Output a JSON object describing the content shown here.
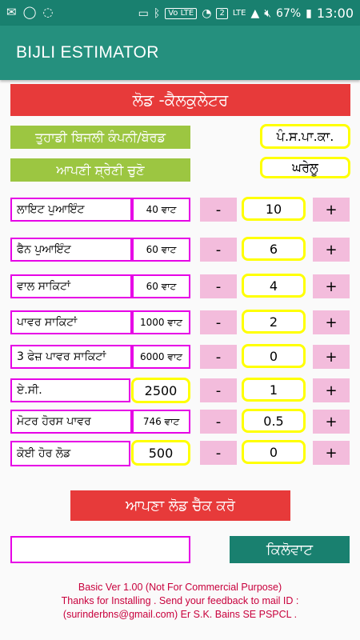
{
  "status_bar": {
    "left_icons": [
      "sms-icon",
      "whatsapp-icon",
      "messenger-icon"
    ],
    "battery": "67%",
    "time": "13:00",
    "volte": "Vo LTE",
    "sim2": "2",
    "lte": "LTE"
  },
  "app": {
    "title": "BIJLI ESTIMATOR"
  },
  "header": {
    "title": "ਲੋਡ -ਕੈਲਕੁਲੇਟਰ"
  },
  "company": {
    "label": "ਤੁਹਾਡੀ ਬਿਜਲੀ ਕੰਪਨੀ/ਬੋਰਡ",
    "value": "ਪੰ.ਸ.ਪਾ.ਕਾ."
  },
  "category": {
    "label": "ਆਪਣੀ ਸ਼੍ਰੇਣੀ ਚੁਣੋ",
    "value": "ਘਰੇਲੂ"
  },
  "load_items": [
    {
      "name": "ਲਾਇਟ ਪੁਆਇੰਟ",
      "watt": "40 ਵਾਟ",
      "qty": "10"
    },
    {
      "name": "ਫੈਨ ਪੁਆਇੰਟ",
      "watt": "60 ਵਾਟ",
      "qty": "6"
    },
    {
      "name": "ਵਾਲ ਸਾਕਿਟਾਂ",
      "watt": "60 ਵਾਟ",
      "qty": "4"
    },
    {
      "name": "ਪਾਵਰ ਸਾਕਿਟਾਂ",
      "watt": "1000 ਵਾਟ",
      "qty": "2"
    },
    {
      "name": "3 ਫੇਜ਼ ਪਾਵਰ ਸਾਕਿਟਾਂ",
      "watt": "6000 ਵਾਟ",
      "qty": "0"
    },
    {
      "name": "ਏ.ਸੀ.",
      "watt": "2500",
      "qty": "1"
    },
    {
      "name": "ਮੋਟਰ ਹੋਰਸ ਪਾਵਰ",
      "watt": "746 ਵਾਟ",
      "qty": "0.5"
    },
    {
      "name": "ਕੋਈ ਹੋਰ ਲੋਡ",
      "watt": "500",
      "qty": "0"
    }
  ],
  "buttons": {
    "minus": "-",
    "plus": "+",
    "check": "ਆਪਣਾ ਲੋਡ ਚੈੱਕ ਕਰੋ",
    "unit": "ਕਿਲੋਵਾਟ"
  },
  "result": {
    "value": ""
  },
  "footer": {
    "line1": "Basic Ver 1.00 (Not For Commercial Purpose)",
    "line2": "Thanks for Installing . Send your feedback to mail ID :",
    "line3": "(surinderbns@gmail.com) Er S.K. Bains SE PSPCL ."
  }
}
